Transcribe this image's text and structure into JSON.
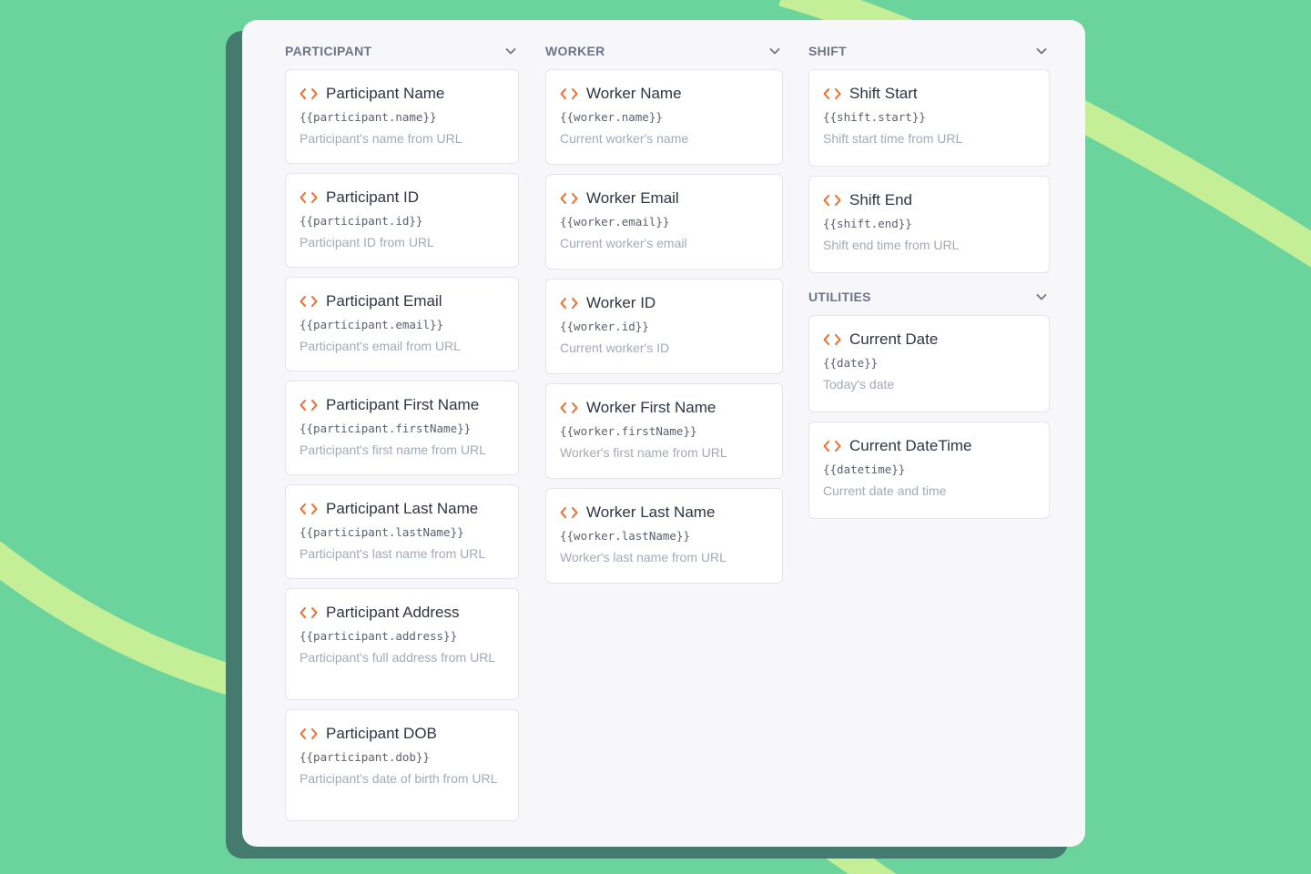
{
  "theme": {
    "background": "#6bd39c",
    "accent_arc": "#c5ef96",
    "shadow": "#457b6f",
    "panel": "#f7f7fa",
    "icon_color": "#f26b2a"
  },
  "participant": {
    "title": "PARTICIPANT",
    "items": [
      {
        "name": "Participant Name",
        "var": "{{participant.name}}",
        "desc": "Participant's name from URL"
      },
      {
        "name": "Participant ID",
        "var": "{{participant.id}}",
        "desc": "Participant ID from URL"
      },
      {
        "name": "Participant Email",
        "var": "{{participant.email}}",
        "desc": "Participant's email from URL"
      },
      {
        "name": "Participant First Name",
        "var": "{{participant.firstName}}",
        "desc": "Participant's first name from URL"
      },
      {
        "name": "Participant Last Name",
        "var": "{{participant.lastName}}",
        "desc": "Participant's last name from URL"
      },
      {
        "name": "Participant Address",
        "var": "{{participant.address}}",
        "desc": "Participant's full address from URL"
      },
      {
        "name": "Participant DOB",
        "var": "{{participant.dob}}",
        "desc": "Participant's date of birth from URL"
      }
    ]
  },
  "worker": {
    "title": "WORKER",
    "items": [
      {
        "name": "Worker Name",
        "var": "{{worker.name}}",
        "desc": "Current worker's name"
      },
      {
        "name": "Worker Email",
        "var": "{{worker.email}}",
        "desc": "Current worker's email"
      },
      {
        "name": "Worker ID",
        "var": "{{worker.id}}",
        "desc": "Current worker's ID"
      },
      {
        "name": "Worker First Name",
        "var": "{{worker.firstName}}",
        "desc": "Worker's first name from URL"
      },
      {
        "name": "Worker Last Name",
        "var": "{{worker.lastName}}",
        "desc": "Worker's last name from URL"
      }
    ]
  },
  "shift": {
    "title": "SHIFT",
    "items": [
      {
        "name": "Shift Start",
        "var": "{{shift.start}}",
        "desc": "Shift start time from URL"
      },
      {
        "name": "Shift End",
        "var": "{{shift.end}}",
        "desc": "Shift end time from URL"
      }
    ]
  },
  "utilities": {
    "title": "UTILITIES",
    "items": [
      {
        "name": "Current Date",
        "var": "{{date}}",
        "desc": "Today's date"
      },
      {
        "name": "Current DateTime",
        "var": "{{datetime}}",
        "desc": "Current date and time"
      }
    ]
  }
}
